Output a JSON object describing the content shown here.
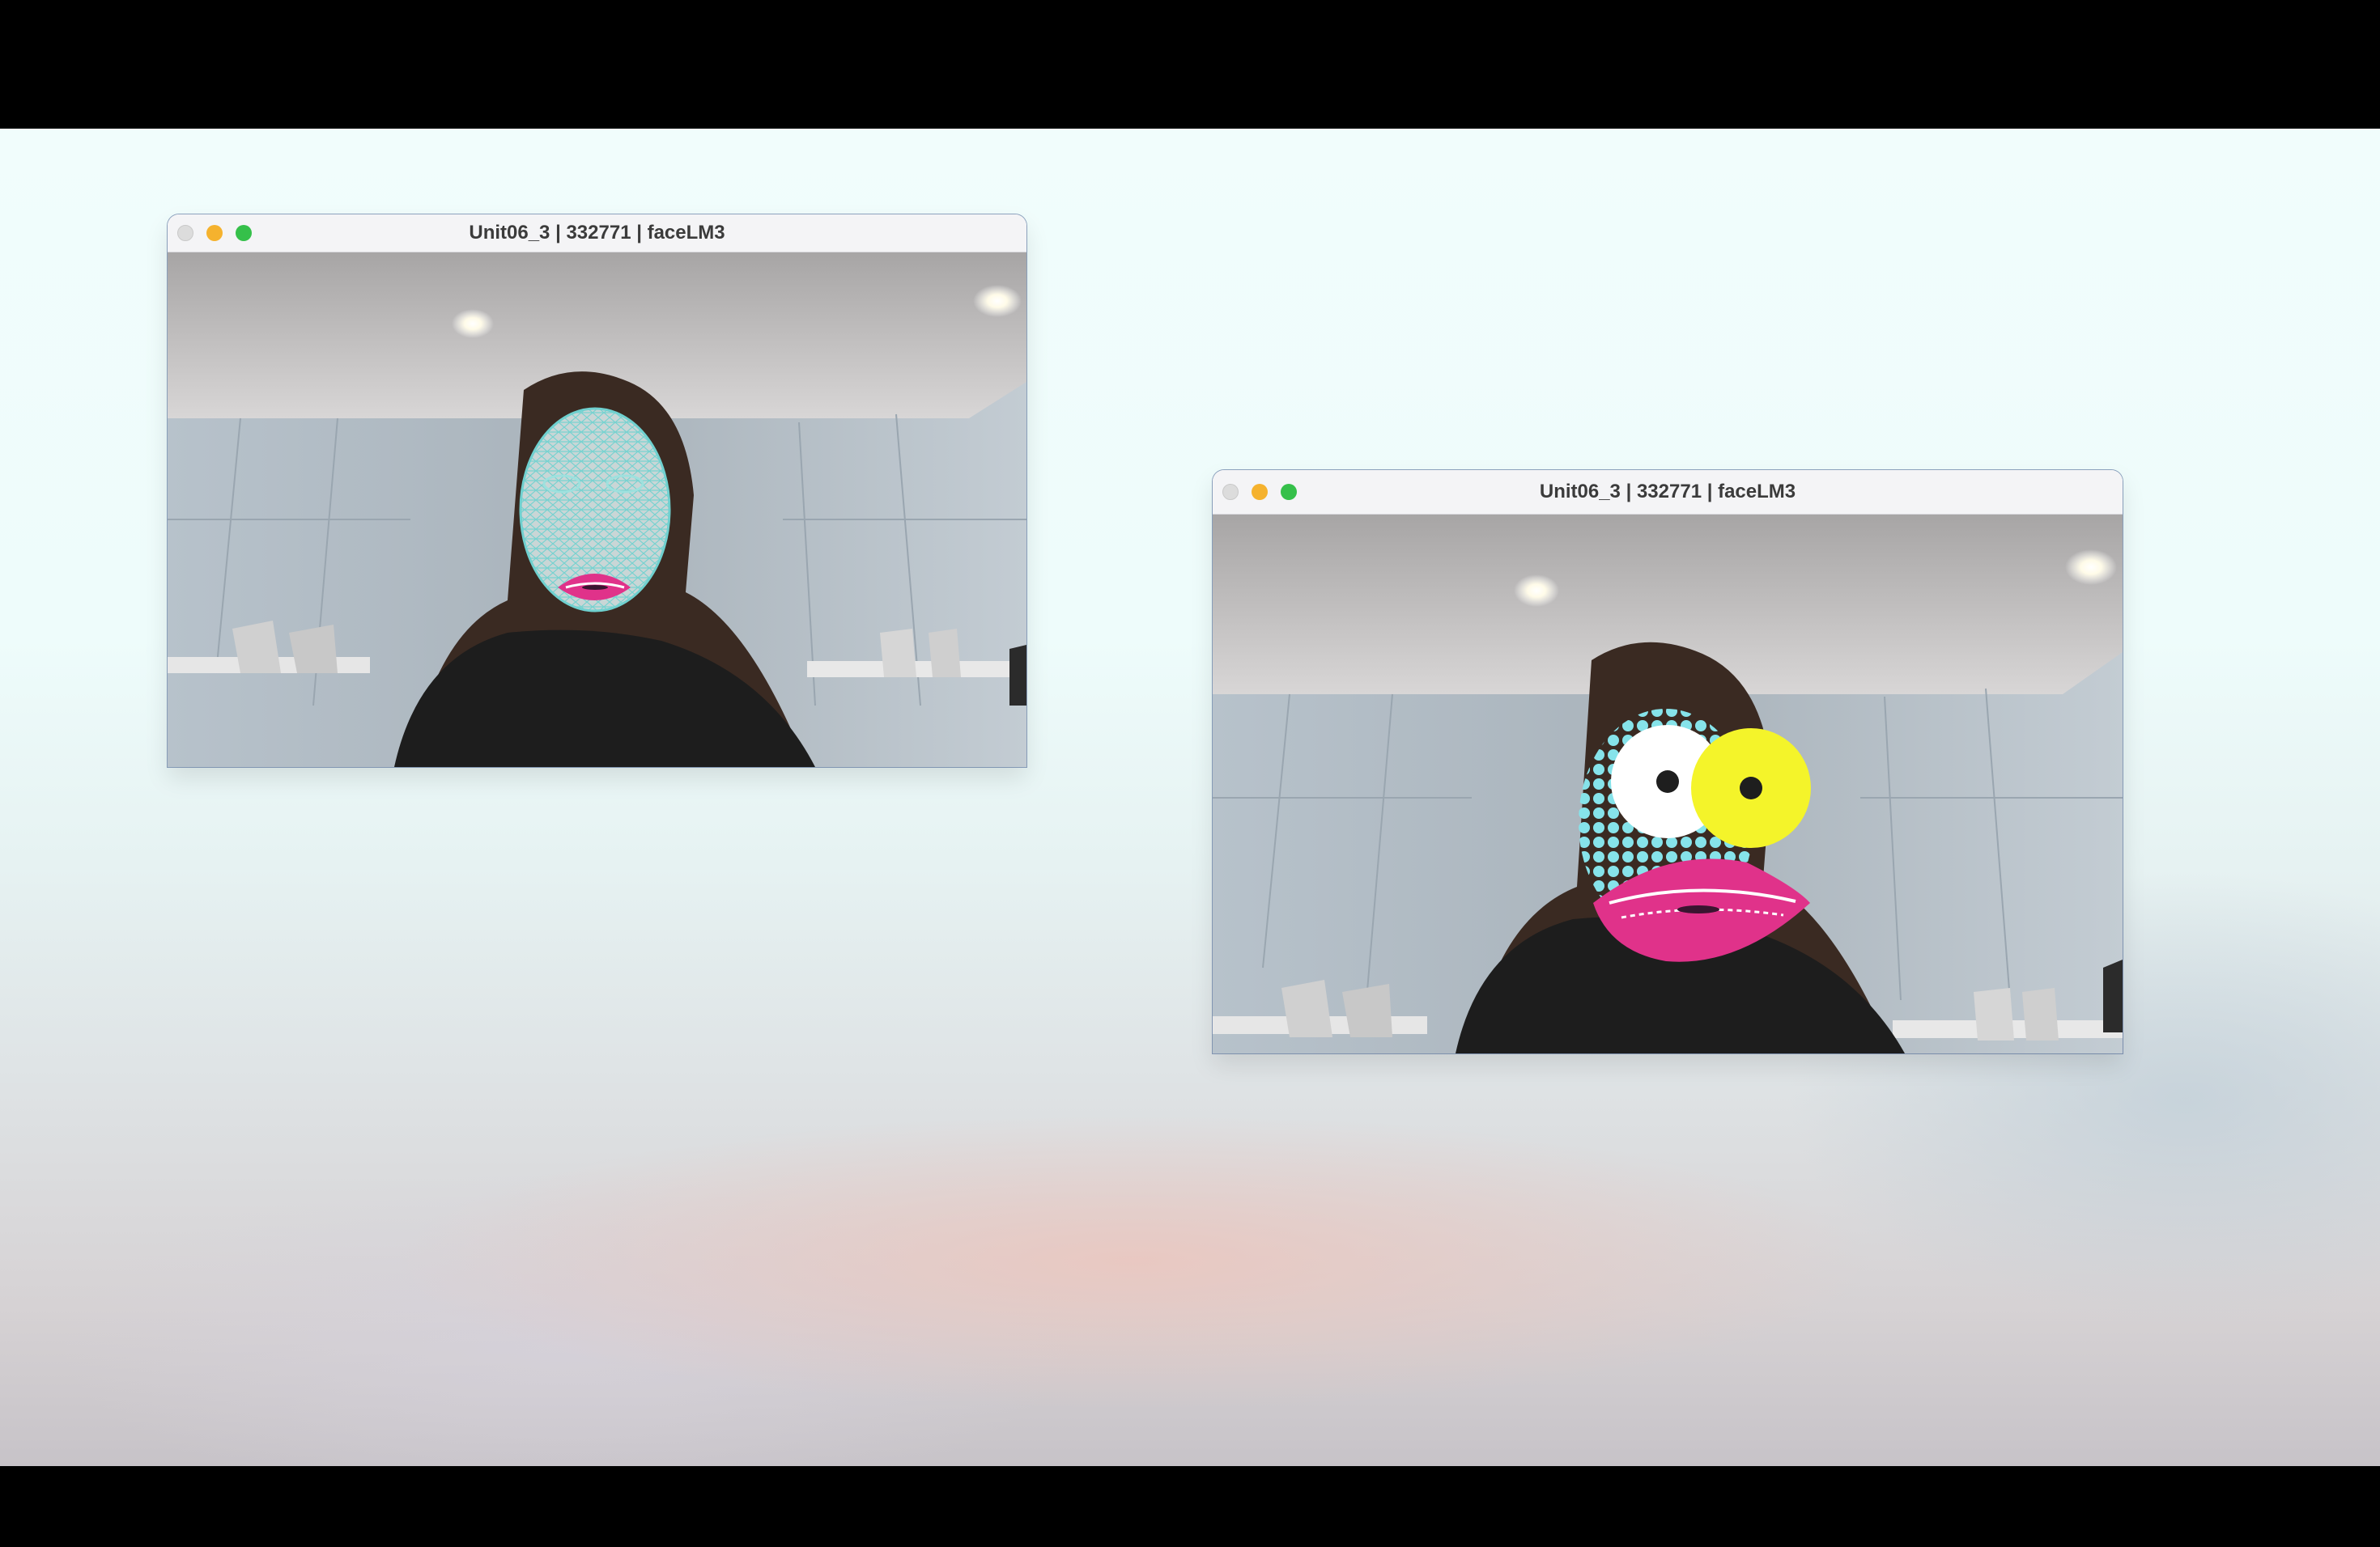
{
  "desktop": {
    "windows": [
      {
        "title": "Unit06_3 | 332771 | faceLM3",
        "overlay": "face-mesh-with-lips",
        "controls": [
          "close-button",
          "minimize-button",
          "zoom-button"
        ]
      },
      {
        "title": "Unit06_3 | 332771 | faceLM3",
        "overlay": "cartoon-eyes-dots-lips",
        "controls": [
          "close-button",
          "minimize-button",
          "zoom-button"
        ]
      }
    ]
  },
  "colors": {
    "lips": "#e0328a",
    "mesh": "#7fd6d4",
    "dots": "#86e3ea",
    "eye_right": "#f4f42a",
    "traffic_red_inactive": "#dcdcdc",
    "traffic_yellow": "#f5b22e",
    "traffic_green": "#35c04a"
  }
}
